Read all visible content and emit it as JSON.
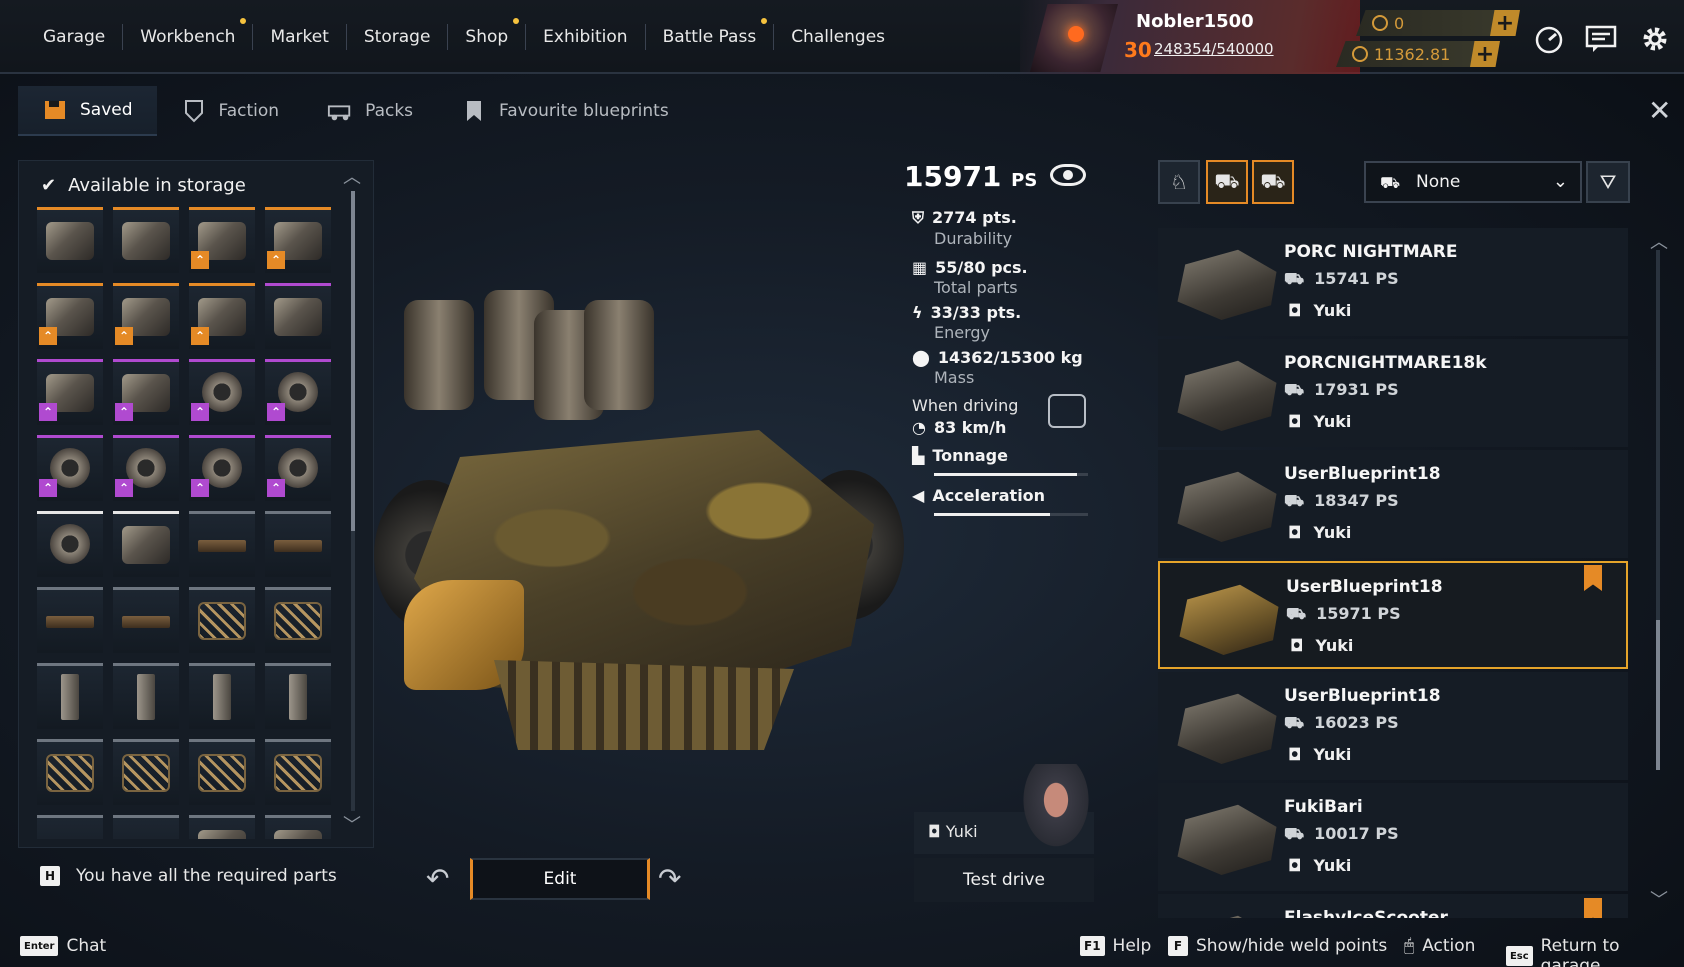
{
  "nav": {
    "items": [
      {
        "label": "Garage",
        "dot": false
      },
      {
        "label": "Workbench",
        "dot": true
      },
      {
        "label": "Market",
        "dot": false
      },
      {
        "label": "Storage",
        "dot": false
      },
      {
        "label": "Shop",
        "dot": true
      },
      {
        "label": "Exhibition",
        "dot": false
      },
      {
        "label": "Battle Pass",
        "dot": true
      },
      {
        "label": "Challenges",
        "dot": false
      }
    ]
  },
  "profile": {
    "name": "Nobler1500",
    "level": "30",
    "xp": "248354/540000",
    "currency_1": "0",
    "currency_2": "11362.81"
  },
  "tabs": [
    {
      "label": "Saved",
      "active": true,
      "icon": "floppy-icon"
    },
    {
      "label": "Faction",
      "active": false,
      "icon": "faction-shield-icon"
    },
    {
      "label": "Packs",
      "active": false,
      "icon": "vehicle-packs-icon"
    },
    {
      "label": "Favourite blueprints",
      "active": false,
      "icon": "bookmark-icon"
    }
  ],
  "storage": {
    "header": "Available in storage",
    "items": [
      {
        "rarity": "orange",
        "shape": "",
        "badge": ""
      },
      {
        "rarity": "orange",
        "shape": "",
        "badge": ""
      },
      {
        "rarity": "orange",
        "shape": "",
        "badge": "o"
      },
      {
        "rarity": "orange",
        "shape": "",
        "badge": "o"
      },
      {
        "rarity": "orange",
        "shape": "",
        "badge": "o"
      },
      {
        "rarity": "orange",
        "shape": "",
        "badge": "o"
      },
      {
        "rarity": "orange",
        "shape": "",
        "badge": "o"
      },
      {
        "rarity": "purple",
        "shape": "",
        "badge": ""
      },
      {
        "rarity": "purple",
        "shape": "",
        "badge": "p"
      },
      {
        "rarity": "purple",
        "shape": "",
        "badge": "p"
      },
      {
        "rarity": "purple",
        "shape": "gear",
        "badge": "p"
      },
      {
        "rarity": "purple",
        "shape": "gear",
        "badge": "p"
      },
      {
        "rarity": "purple",
        "shape": "gear",
        "badge": "p"
      },
      {
        "rarity": "purple",
        "shape": "gear",
        "badge": "p"
      },
      {
        "rarity": "purple",
        "shape": "gear",
        "badge": "p"
      },
      {
        "rarity": "purple",
        "shape": "gear",
        "badge": "p"
      },
      {
        "rarity": "white",
        "shape": "gear",
        "badge": ""
      },
      {
        "rarity": "white",
        "shape": "",
        "badge": ""
      },
      {
        "rarity": "gray",
        "shape": "flat",
        "badge": ""
      },
      {
        "rarity": "gray",
        "shape": "flat",
        "badge": ""
      },
      {
        "rarity": "gray",
        "shape": "flat",
        "badge": ""
      },
      {
        "rarity": "gray",
        "shape": "flat",
        "badge": ""
      },
      {
        "rarity": "gray",
        "shape": "cage",
        "badge": ""
      },
      {
        "rarity": "gray",
        "shape": "cage",
        "badge": ""
      },
      {
        "rarity": "gray",
        "shape": "tall",
        "badge": ""
      },
      {
        "rarity": "gray",
        "shape": "tall",
        "badge": ""
      },
      {
        "rarity": "gray",
        "shape": "tall",
        "badge": ""
      },
      {
        "rarity": "gray",
        "shape": "tall",
        "badge": ""
      },
      {
        "rarity": "gray",
        "shape": "cage",
        "badge": ""
      },
      {
        "rarity": "gray",
        "shape": "cage",
        "badge": ""
      },
      {
        "rarity": "gray",
        "shape": "cage",
        "badge": ""
      },
      {
        "rarity": "gray",
        "shape": "cage",
        "badge": ""
      },
      {
        "rarity": "gray",
        "shape": "flat",
        "badge": ""
      },
      {
        "rarity": "gray",
        "shape": "flat",
        "badge": ""
      },
      {
        "rarity": "gray",
        "shape": "",
        "badge": ""
      },
      {
        "rarity": "gray",
        "shape": "",
        "badge": ""
      }
    ],
    "required_key": "H",
    "required_text": "You have all the required parts"
  },
  "stats": {
    "ps_value": "15971",
    "ps_unit": "PS",
    "durability": "2774 pts.",
    "durability_label": "Durability",
    "parts": "55/80 pcs.",
    "parts_label": "Total parts",
    "energy": "33/33 pts.",
    "energy_label": "Energy",
    "mass": "14362/15300 kg",
    "mass_label": "Mass",
    "when_driving": "When driving",
    "speed": "83 km/h",
    "tonnage_label": "Tonnage",
    "tonnage_level": 0.93,
    "acceleration_label": "Acceleration",
    "acceleration_level": 0.75
  },
  "actions": {
    "edit": "Edit",
    "driver": "Yuki",
    "test_drive": "Test drive"
  },
  "filter": {
    "dropdown_value": "None"
  },
  "blueprints": [
    {
      "name": "PORC NIGHTMARE",
      "ps": "15741 PS",
      "owner": "Yuki",
      "selected": false,
      "bookmarked": false
    },
    {
      "name": "PORCNIGHTMARE18k",
      "ps": "17931 PS",
      "owner": "Yuki",
      "selected": false,
      "bookmarked": false
    },
    {
      "name": "UserBlueprint18",
      "ps": "18347 PS",
      "owner": "Yuki",
      "selected": false,
      "bookmarked": false
    },
    {
      "name": "UserBlueprint18",
      "ps": "15971 PS",
      "owner": "Yuki",
      "selected": true,
      "bookmarked": true
    },
    {
      "name": "UserBlueprint18",
      "ps": "16023 PS",
      "owner": "Yuki",
      "selected": false,
      "bookmarked": false
    },
    {
      "name": "FukiBari",
      "ps": "10017 PS",
      "owner": "Yuki",
      "selected": false,
      "bookmarked": false
    },
    {
      "name": "FlashyIceScooter",
      "ps": "",
      "owner": "",
      "selected": false,
      "bookmarked": true
    }
  ],
  "bottom": {
    "chat_key": "Enter",
    "chat": "Chat",
    "help_key": "F1",
    "help": "Help",
    "weld_key": "F",
    "weld": "Show/hide weld points",
    "action": "Action",
    "return_key": "Esc",
    "return": "Return to garage"
  },
  "colors": {
    "accent_orange": "#e58a26",
    "epic_purple": "#b04ad0",
    "selection_gold": "#e5a42a"
  }
}
